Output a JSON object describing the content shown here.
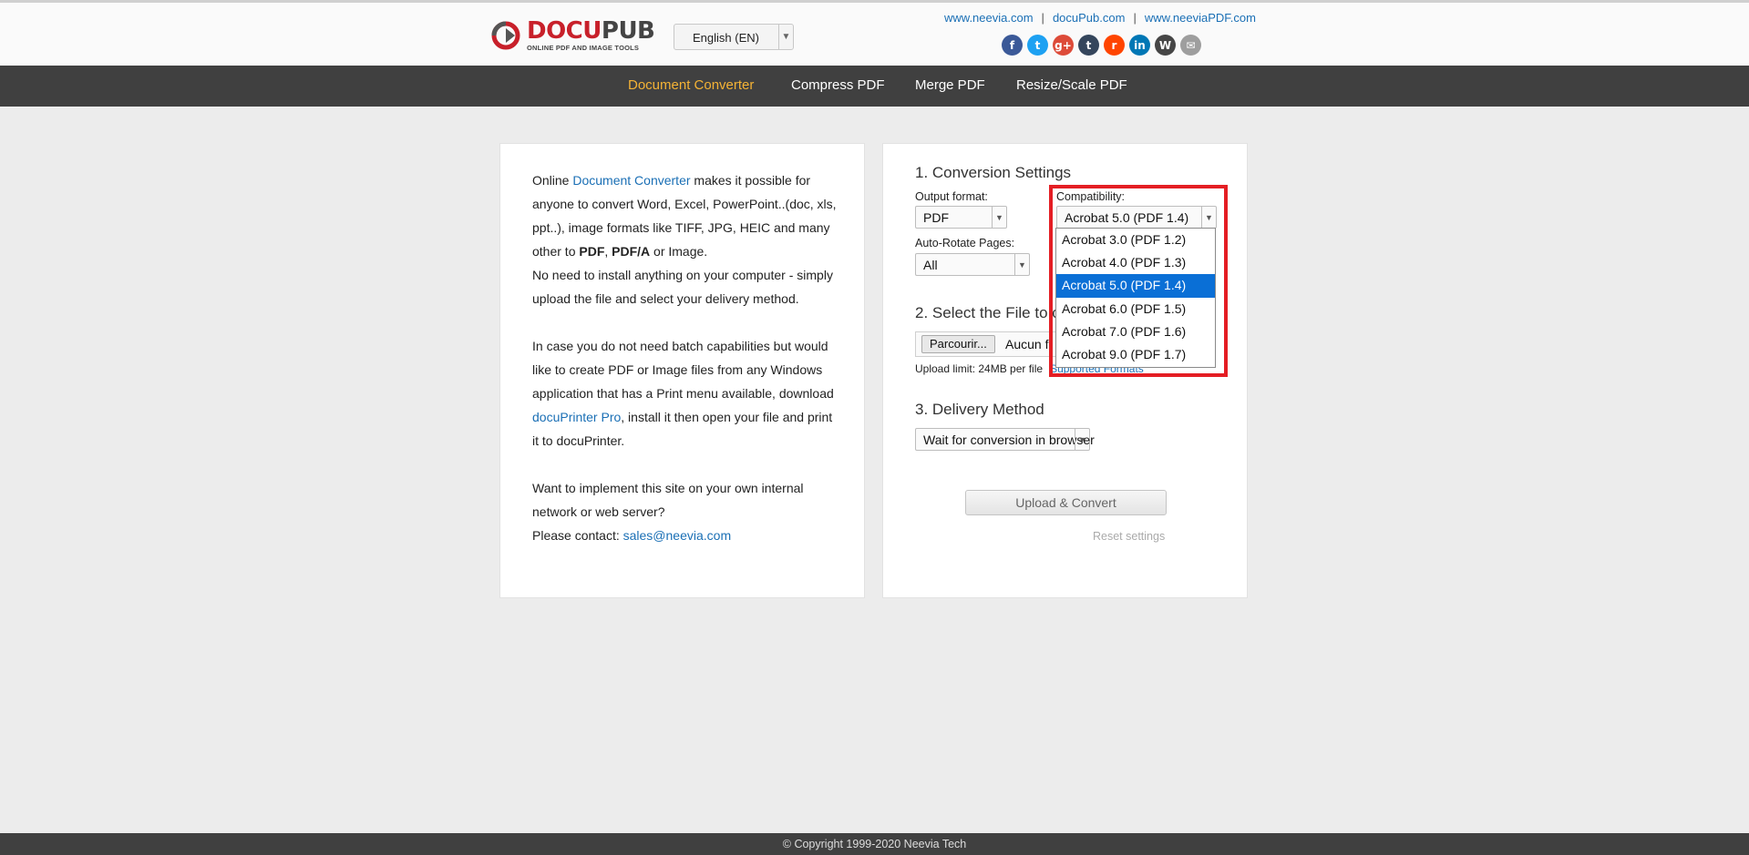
{
  "header": {
    "logo": {
      "title_a": "DOCU",
      "title_b": "PUB",
      "subtitle": "ONLINE PDF AND IMAGE TOOLS"
    },
    "language": {
      "selected": "English (EN)"
    },
    "links": [
      "www.neevia.com",
      "docuPub.com",
      "www.neeviaPDF.com"
    ],
    "social": [
      {
        "name": "facebook-icon",
        "glyph": "f",
        "color": "#3b5998"
      },
      {
        "name": "twitter-icon",
        "glyph": "t",
        "color": "#1da1f2"
      },
      {
        "name": "google-plus-icon",
        "glyph": "g+",
        "color": "#dd4b39"
      },
      {
        "name": "tumblr-icon",
        "glyph": "t",
        "color": "#35465c"
      },
      {
        "name": "reddit-icon",
        "glyph": "r",
        "color": "#ff4500"
      },
      {
        "name": "linkedin-icon",
        "glyph": "in",
        "color": "#0077b5"
      },
      {
        "name": "wordpress-icon",
        "glyph": "W",
        "color": "#464646"
      },
      {
        "name": "email-icon",
        "glyph": "✉",
        "color": "#9e9e9e"
      }
    ]
  },
  "nav": {
    "items": [
      "Document Converter",
      "Compress PDF",
      "Merge PDF",
      "Resize/Scale PDF"
    ]
  },
  "left_panel": {
    "p1_a": "Online ",
    "p1_link": "Document Converter",
    "p1_b": " makes it possible for anyone to convert Word, Excel, PowerPoint..(doc, xls, ppt..), image formats like TIFF, JPG, HEIC and many other to ",
    "p1_bold1": "PDF",
    "p1_c": ", ",
    "p1_bold2": "PDF/A",
    "p1_d": " or Image.",
    "p2": "No need to install anything on your computer - simply upload the file and select your delivery method.",
    "p3_a": "In case you do not need batch capabilities but would like to create PDF or Image files from any Windows application that has a Print menu available, download ",
    "p3_link": "docuPrinter Pro",
    "p3_b": ", install it then open your file and print it to docuPrinter.",
    "p4": "Want to implement this site on your own internal network or web server?",
    "p5_a": "Please contact: ",
    "p5_link": "sales@neevia.com"
  },
  "right_panel": {
    "section1_title": "1. Conversion Settings",
    "output_format_label": "Output format:",
    "output_format_value": "PDF",
    "compat_label": "Compatibility:",
    "compat_value": "Acrobat 5.0 (PDF 1.4)",
    "autorotate_label": "Auto-Rotate Pages:",
    "autorotate_value": "All",
    "section2_title": "2. Select the File to c",
    "browse_label": "Parcourir...",
    "file_status": "Aucun fi",
    "upload_limit": "Upload limit: 24MB per file",
    "supported_formats": "Supported Formats",
    "section3_title": "3. Delivery Method",
    "delivery_value": "Wait for conversion in browser",
    "convert_button": "Upload & Convert",
    "reset_link": "Reset settings"
  },
  "compat_options": [
    "Acrobat 3.0 (PDF 1.2)",
    "Acrobat 4.0 (PDF 1.3)",
    "Acrobat 5.0 (PDF 1.4)",
    "Acrobat 6.0 (PDF 1.5)",
    "Acrobat 7.0 (PDF 1.6)",
    "Acrobat 9.0 (PDF 1.7)"
  ],
  "compat_selected_index": 2,
  "footer": {
    "text": "© Copyright 1999-2020 Neevia Tech"
  },
  "colors": {
    "nav_bg": "#404040",
    "nav_active": "#f5b335",
    "link": "#1a6fb5",
    "highlight": "#e41e24",
    "selected_option": "#0a6fd6"
  }
}
